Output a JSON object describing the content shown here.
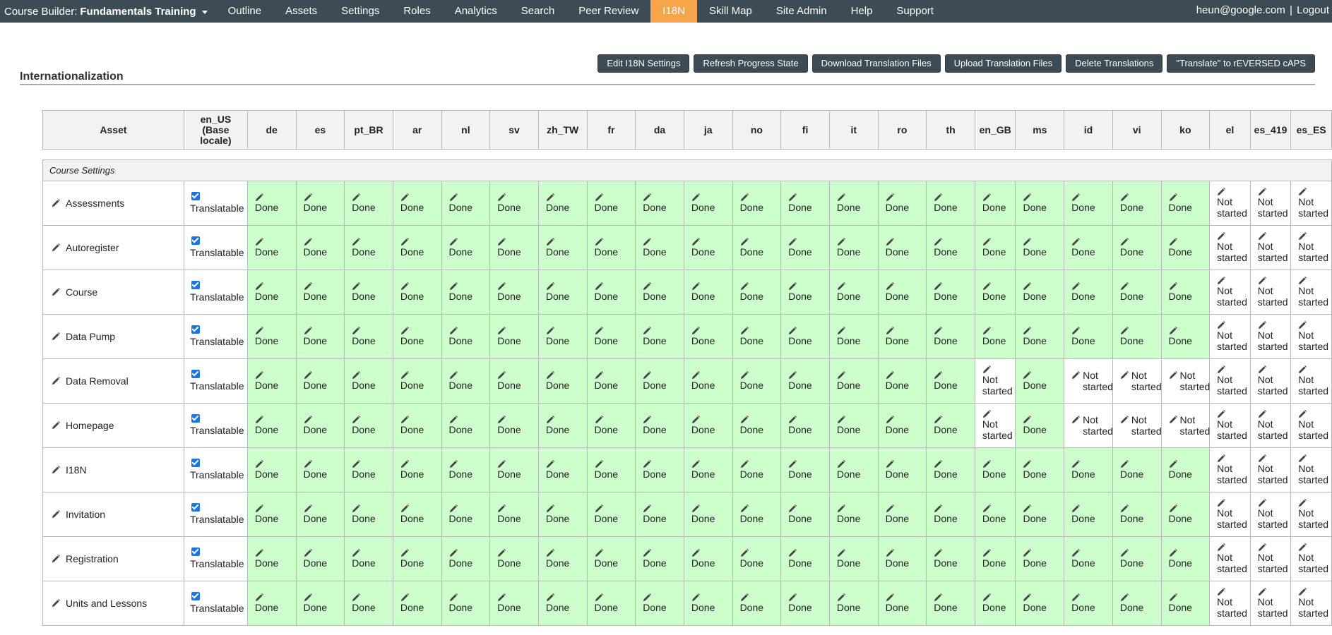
{
  "app": {
    "prefix": "Course Builder:",
    "course_name": "Fundamentals Training"
  },
  "nav": [
    {
      "label": "Outline"
    },
    {
      "label": "Assets"
    },
    {
      "label": "Settings"
    },
    {
      "label": "Roles"
    },
    {
      "label": "Analytics"
    },
    {
      "label": "Search"
    },
    {
      "label": "Peer Review"
    },
    {
      "label": "I18N",
      "active": true
    },
    {
      "label": "Skill Map"
    },
    {
      "label": "Site Admin"
    },
    {
      "label": "Help"
    },
    {
      "label": "Support"
    }
  ],
  "user": {
    "email": "heun@google.com",
    "separator": "|",
    "logout": "Logout"
  },
  "page": {
    "title": "Internationalization"
  },
  "actions": [
    "Edit I18N Settings",
    "Refresh Progress State",
    "Download Translation Files",
    "Upload Translation Files",
    "Delete Translations",
    "\"Translate\" to rEVERSED cAPS"
  ],
  "table": {
    "asset_header": "Asset",
    "base_locale_header": [
      "en_US",
      "(Base",
      "locale)"
    ],
    "locales": [
      "de",
      "es",
      "pt_BR",
      "ar",
      "nl",
      "sv",
      "zh_TW",
      "fr",
      "da",
      "ja",
      "no",
      "fi",
      "it",
      "ro",
      "th",
      "en_GB",
      "ms",
      "id",
      "vi",
      "ko",
      "el",
      "es_419",
      "es_ES"
    ],
    "section": "Course Settings",
    "translatable_label": "Translatable",
    "status_labels": {
      "done": "Done",
      "not_started": "Not started"
    },
    "rows": [
      {
        "asset": "Assessments",
        "statuses": [
          "done",
          "done",
          "done",
          "done",
          "done",
          "done",
          "done",
          "done",
          "done",
          "done",
          "done",
          "done",
          "done",
          "done",
          "done",
          "done",
          "done",
          "done",
          "done",
          "done",
          "not_started",
          "not_started",
          "not_started"
        ]
      },
      {
        "asset": "Autoregister",
        "statuses": [
          "done",
          "done",
          "done",
          "done",
          "done",
          "done",
          "done",
          "done",
          "done",
          "done",
          "done",
          "done",
          "done",
          "done",
          "done",
          "done",
          "done",
          "done",
          "done",
          "done",
          "not_started",
          "not_started",
          "not_started"
        ]
      },
      {
        "asset": "Course",
        "statuses": [
          "done",
          "done",
          "done",
          "done",
          "done",
          "done",
          "done",
          "done",
          "done",
          "done",
          "done",
          "done",
          "done",
          "done",
          "done",
          "done",
          "done",
          "done",
          "done",
          "done",
          "not_started",
          "not_started",
          "not_started"
        ]
      },
      {
        "asset": "Data Pump",
        "statuses": [
          "done",
          "done",
          "done",
          "done",
          "done",
          "done",
          "done",
          "done",
          "done",
          "done",
          "done",
          "done",
          "done",
          "done",
          "done",
          "done",
          "done",
          "done",
          "done",
          "done",
          "not_started",
          "not_started",
          "not_started"
        ]
      },
      {
        "asset": "Data Removal",
        "statuses": [
          "done",
          "done",
          "done",
          "done",
          "done",
          "done",
          "done",
          "done",
          "done",
          "done",
          "done",
          "done",
          "done",
          "done",
          "done",
          "not_started",
          "done",
          "not_started",
          "not_started",
          "not_started",
          "not_started",
          "not_started",
          "not_started"
        ]
      },
      {
        "asset": "Homepage",
        "statuses": [
          "done",
          "done",
          "done",
          "done",
          "done",
          "done",
          "done",
          "done",
          "done",
          "done",
          "done",
          "done",
          "done",
          "done",
          "done",
          "not_started",
          "done",
          "not_started",
          "not_started",
          "not_started",
          "not_started",
          "not_started",
          "not_started"
        ]
      },
      {
        "asset": "I18N",
        "statuses": [
          "done",
          "done",
          "done",
          "done",
          "done",
          "done",
          "done",
          "done",
          "done",
          "done",
          "done",
          "done",
          "done",
          "done",
          "done",
          "done",
          "done",
          "done",
          "done",
          "done",
          "not_started",
          "not_started",
          "not_started"
        ]
      },
      {
        "asset": "Invitation",
        "statuses": [
          "done",
          "done",
          "done",
          "done",
          "done",
          "done",
          "done",
          "done",
          "done",
          "done",
          "done",
          "done",
          "done",
          "done",
          "done",
          "done",
          "done",
          "done",
          "done",
          "done",
          "not_started",
          "not_started",
          "not_started"
        ]
      },
      {
        "asset": "Registration",
        "statuses": [
          "done",
          "done",
          "done",
          "done",
          "done",
          "done",
          "done",
          "done",
          "done",
          "done",
          "done",
          "done",
          "done",
          "done",
          "done",
          "done",
          "done",
          "done",
          "done",
          "done",
          "not_started",
          "not_started",
          "not_started"
        ]
      },
      {
        "asset": "Units and Lessons",
        "statuses": [
          "done",
          "done",
          "done",
          "done",
          "done",
          "done",
          "done",
          "done",
          "done",
          "done",
          "done",
          "done",
          "done",
          "done",
          "done",
          "done",
          "done",
          "done",
          "done",
          "done",
          "not_started",
          "not_started",
          "not_started"
        ]
      }
    ]
  },
  "colors": {
    "nav_bg": "#3d4b55",
    "nav_active": "#f6a54a",
    "done_bg": "#ccffcc",
    "not_started_bg": "#ffffff",
    "button_bg": "#3d4b55"
  },
  "icons": {
    "edit": "pencil-icon",
    "translatable": "checkbox-checked",
    "menu": "caret-down-icon"
  }
}
